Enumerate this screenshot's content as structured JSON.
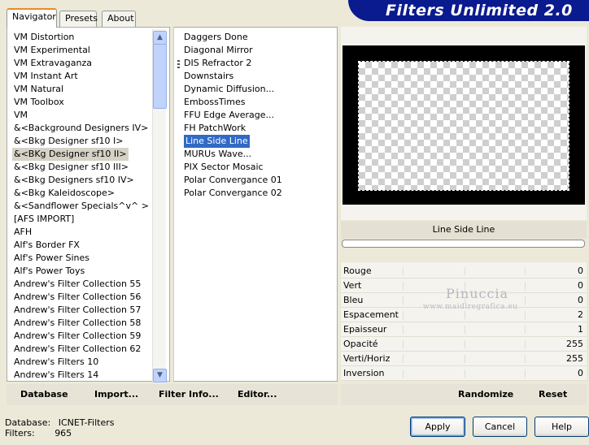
{
  "title": "Filters Unlimited 2.0",
  "tabs": [
    {
      "label": "Navigator",
      "active": true
    },
    {
      "label": "Presets",
      "active": false
    },
    {
      "label": "About",
      "active": false
    }
  ],
  "categories": [
    "VM Distortion",
    "VM Experimental",
    "VM Extravaganza",
    "VM Instant Art",
    "VM Natural",
    "VM Toolbox",
    "VM",
    "&<Background Designers IV>",
    "&<Bkg Designer sf10 I>",
    "&<BKg Designer sf10 II>",
    "&<Bkg Designer sf10 III>",
    "&<Bkg Designers sf10 IV>",
    "&<Bkg Kaleidoscope>",
    "&<Sandflower Specials^v^ >",
    "[AFS IMPORT]",
    "AFH",
    "Alf's Border FX",
    "Alf's Power Sines",
    "Alf's Power Toys",
    "Andrew's Filter Collection 55",
    "Andrew's Filter Collection 56",
    "Andrew's Filter Collection 57",
    "Andrew's Filter Collection 58",
    "Andrew's Filter Collection 59",
    "Andrew's Filter Collection 62",
    "Andrew's Filters 10",
    "Andrew's Filters 14"
  ],
  "selected_category_index": 9,
  "filters": [
    "Daggers Done",
    "Diagonal Mirror",
    "DIS Refractor 2",
    "Downstairs",
    "Dynamic Diffusion...",
    "EmbossTimes",
    "FFU Edge Average...",
    "FH PatchWork",
    "Line Side Line",
    "MURUs Wave...",
    "PIX Sector Mosaic",
    "Polar Convergance 01",
    "Polar Convergance 02"
  ],
  "selected_filter_index": 8,
  "selected_filter_name": "Line Side Line",
  "parameters": [
    {
      "label": "Rouge",
      "value": "0"
    },
    {
      "label": "Vert",
      "value": "0"
    },
    {
      "label": "Bleu",
      "value": "0"
    },
    {
      "label": "Espacement",
      "value": "2"
    },
    {
      "label": "Epaisseur",
      "value": "1"
    },
    {
      "label": "Opacité",
      "value": "255"
    },
    {
      "label": "Verti/Horiz",
      "value": "255"
    },
    {
      "label": "Inversion",
      "value": "0"
    }
  ],
  "watermark": {
    "name": "Pinuccia",
    "site": "www.maidiregrafica.eu"
  },
  "left_actions": {
    "database": "Database",
    "import": "Import...",
    "filter_info": "Filter Info...",
    "editor": "Editor..."
  },
  "right_actions": {
    "randomize": "Randomize",
    "reset": "Reset"
  },
  "status": {
    "database_label": "Database:",
    "database_value": "ICNET-Filters",
    "filters_label": "Filters:",
    "filters_value": "965"
  },
  "buttons": {
    "apply": "Apply",
    "cancel": "Cancel",
    "help": "Help"
  },
  "colors": {
    "brand": "#0a1a8f",
    "selection": "#316ac5",
    "window": "#ece9d8"
  }
}
